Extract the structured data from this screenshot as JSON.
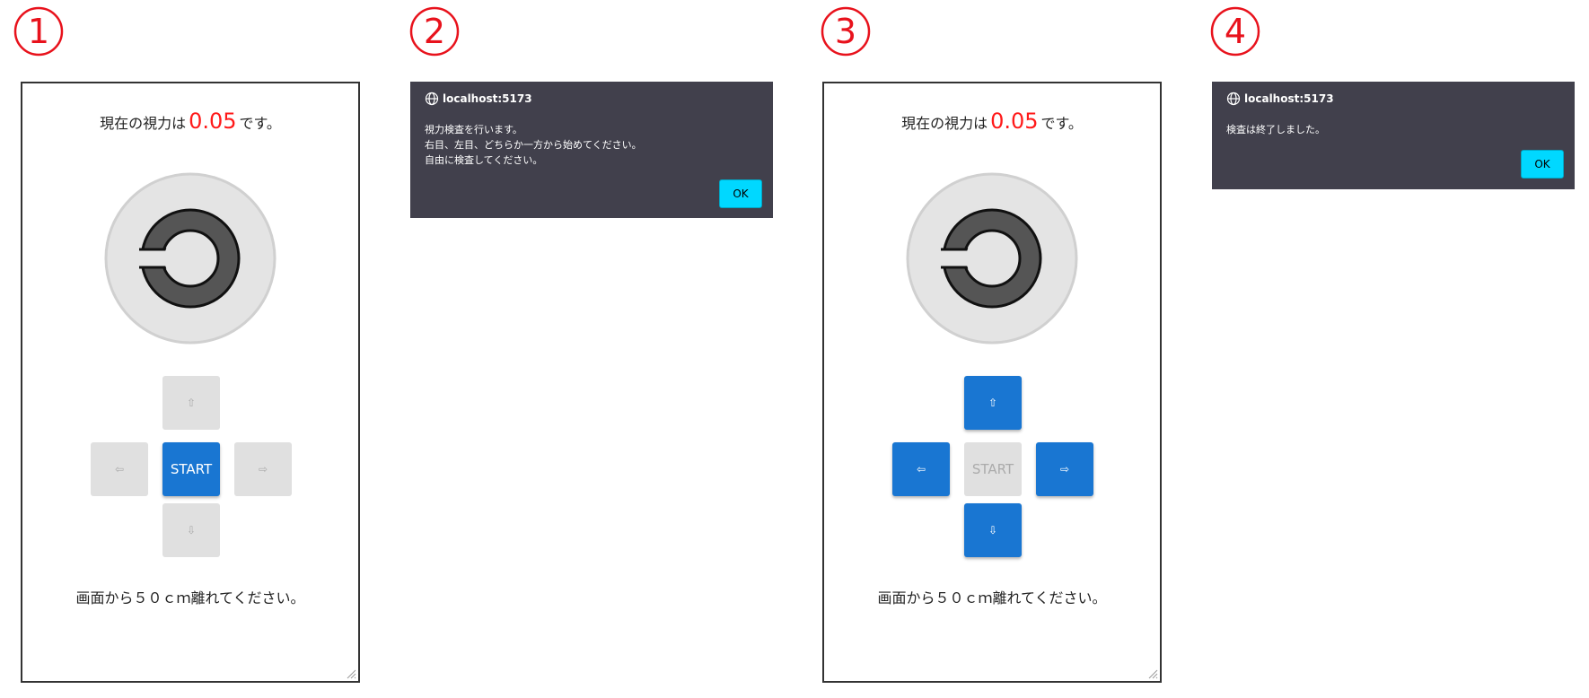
{
  "steps": [
    "1",
    "2",
    "3",
    "4"
  ],
  "colors": {
    "accent": "#1976d2",
    "acuity_red": "#ff1a1a",
    "step_red": "#e8121c",
    "disabled": "#e0e0e0",
    "dialog_bg": "#41404c",
    "ok_button": "#00d8ff"
  },
  "panel1": {
    "acuity_prefix": "現在の視力は",
    "acuity_value": "0.05",
    "acuity_suffix": "です。",
    "buttons": {
      "up": "⇧",
      "left": "⇦",
      "start": "START",
      "right": "⇨",
      "down": "⇩"
    },
    "button_state": "arrows-disabled-start-active",
    "instruction": "画面から５０ｃｍ離れてください。"
  },
  "dialog1": {
    "host": "localhost:5173",
    "lines": [
      "視力検査を行います。",
      "右目、左目、どちらか一方から始めてください。",
      "自由に検査してください。"
    ],
    "ok_label": "OK"
  },
  "panel2": {
    "acuity_prefix": "現在の視力は",
    "acuity_value": "0.05",
    "acuity_suffix": "です。",
    "buttons": {
      "up": "⇧",
      "left": "⇦",
      "start": "START",
      "right": "⇨",
      "down": "⇩"
    },
    "button_state": "arrows-active-start-disabled",
    "instruction": "画面から５０ｃｍ離れてください。"
  },
  "dialog2": {
    "host": "localhost:5173",
    "lines": [
      "検査は終了しました。"
    ],
    "ok_label": "OK"
  },
  "icons": {
    "dialog_host": "globe-icon",
    "target": "landolt-ring-icon",
    "resize": "resize-grip-icon"
  }
}
